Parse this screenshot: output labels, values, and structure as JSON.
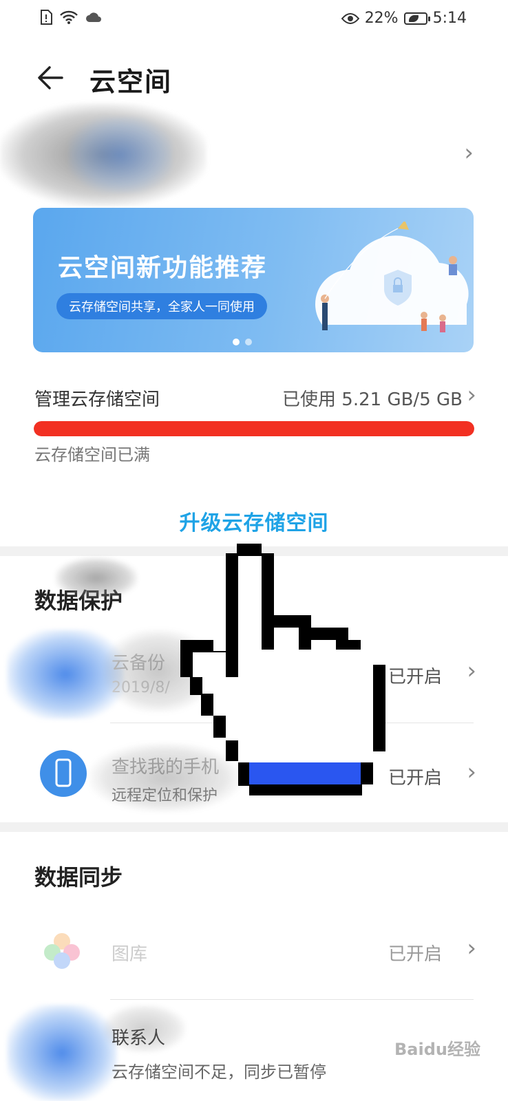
{
  "status_bar": {
    "battery": "22%",
    "time": "5:14",
    "icons": [
      "sim-alert-icon",
      "wifi-icon",
      "cloud-icon",
      "eye-icon",
      "battery-icon"
    ]
  },
  "header": {
    "title": "云空间",
    "back_icon": "arrow-left-icon"
  },
  "banner": {
    "title": "云空间新功能推荐",
    "subtitle": "云存储空间共享，全家人一同使用",
    "page_count": 2,
    "active_page": 1
  },
  "storage": {
    "label": "管理云存储空间",
    "usage": "已使用 5.21 GB/5 GB",
    "fill_fraction": 1.0,
    "status": "云存储空间已满",
    "upgrade": "升级云存储空间",
    "bar_color": "#f23022"
  },
  "data_protection": {
    "title": "数据保护",
    "items": [
      {
        "title": "云备份",
        "subtitle": "2019/8/",
        "status": "已开启",
        "icon": "backup-icon"
      },
      {
        "title": "查找我的手机",
        "subtitle": "远程定位和保护",
        "status": "已开启",
        "icon": "phone-icon"
      }
    ]
  },
  "data_sync": {
    "title": "数据同步",
    "items": [
      {
        "title": "图库",
        "status": "已开启",
        "icon": "gallery-icon"
      },
      {
        "title": "联系人",
        "subtitle": "云存储空间不足，同步已暂停",
        "icon": "contacts-icon"
      }
    ]
  },
  "watermark": "Baidu经验",
  "colors": {
    "accent": "#1fa3e6",
    "danger": "#f23022",
    "banner": "#5aa7ee"
  }
}
